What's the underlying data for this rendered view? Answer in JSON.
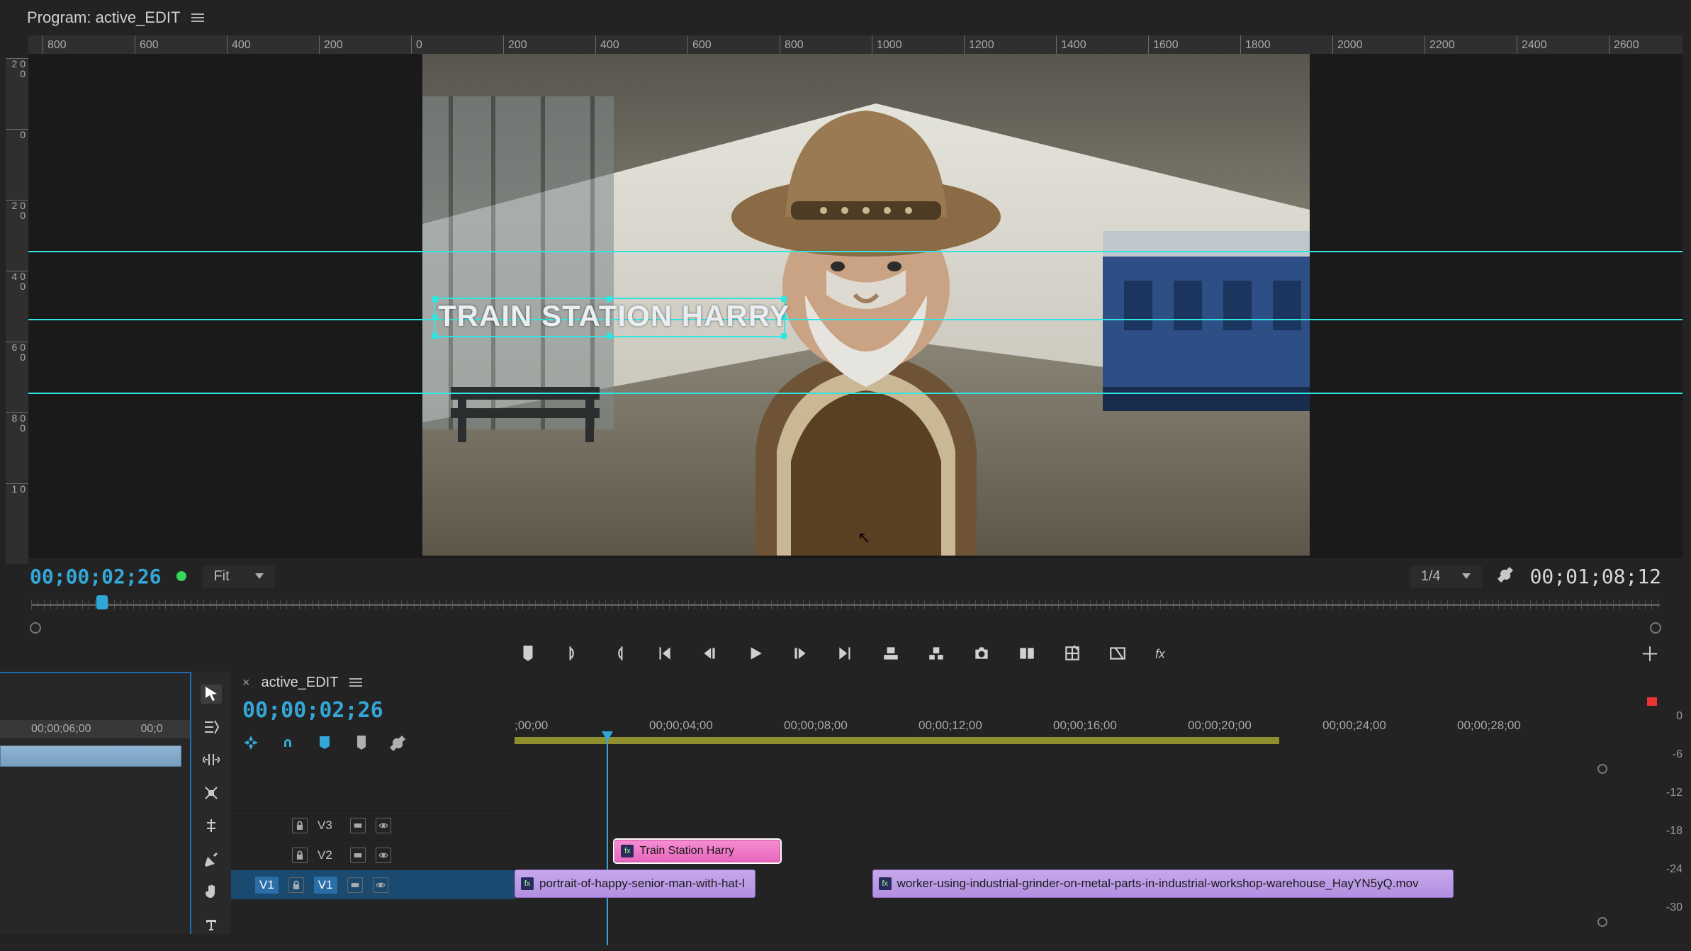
{
  "program": {
    "title": "Program: active_EDIT",
    "overlay_title": "TRAIN STATION HARRY",
    "current_tc": "00;00;02;26",
    "duration_tc": "00;01;08;12",
    "fit_label": "Fit",
    "quality_label": "1/4",
    "h_ruler_ticks": [
      "800",
      "600",
      "400",
      "200",
      "0",
      "200",
      "400",
      "600",
      "800",
      "1000",
      "1200",
      "1400",
      "1600",
      "1800",
      "2000",
      "2200",
      "2400",
      "2600"
    ],
    "v_ruler_ticks": [
      "2 0 0",
      "0",
      "2 0 0",
      "4 0 0",
      "6 0 0",
      "8 0 0",
      "1 0"
    ]
  },
  "transport_icons": {
    "marker": "marker",
    "in": "set-in",
    "out": "set-out",
    "goto_in": "goto-in",
    "step_back": "step-back",
    "play": "play",
    "step_fwd": "step-fwd",
    "goto_out": "goto-out",
    "lift": "lift",
    "extract": "extract",
    "snapshot": "snapshot",
    "insert": "insert",
    "export": "export",
    "compare": "compare",
    "fx": "fx"
  },
  "source": {
    "ruler": [
      "00;00;06;00",
      "00;0"
    ]
  },
  "timeline": {
    "tab_name": "active_EDIT",
    "current_tc": "00;00;02;26",
    "ruler": [
      ";00;00",
      "00;00;04;00",
      "00;00;08;00",
      "00;00;12;00",
      "00;00;16;00",
      "00;00;20;00",
      "00;00;24;00",
      "00;00;28;00"
    ],
    "tracks": [
      {
        "label": "V3",
        "targeted": false
      },
      {
        "label": "V2",
        "targeted": false
      },
      {
        "label": "V1",
        "targeted": true,
        "source": "V1"
      }
    ],
    "clips": [
      {
        "kind": "title",
        "name": "Train Station Harry",
        "left_pct": 9.3,
        "width_pct": 15.4,
        "selected": true
      },
      {
        "kind": "video",
        "name": "portrait-of-happy-senior-man-with-hat-l",
        "left_pct": 0,
        "width_pct": 22.4
      },
      {
        "kind": "video",
        "name": "worker-using-industrial-grinder-on-metal-parts-in-industrial-workshop-warehouse_HayYN5yQ.mov",
        "left_pct": 33.2,
        "width_pct": 54.0
      }
    ]
  },
  "meters": {
    "scale": [
      "0",
      "-6",
      "-12",
      "-18",
      "-24",
      "-30"
    ]
  }
}
